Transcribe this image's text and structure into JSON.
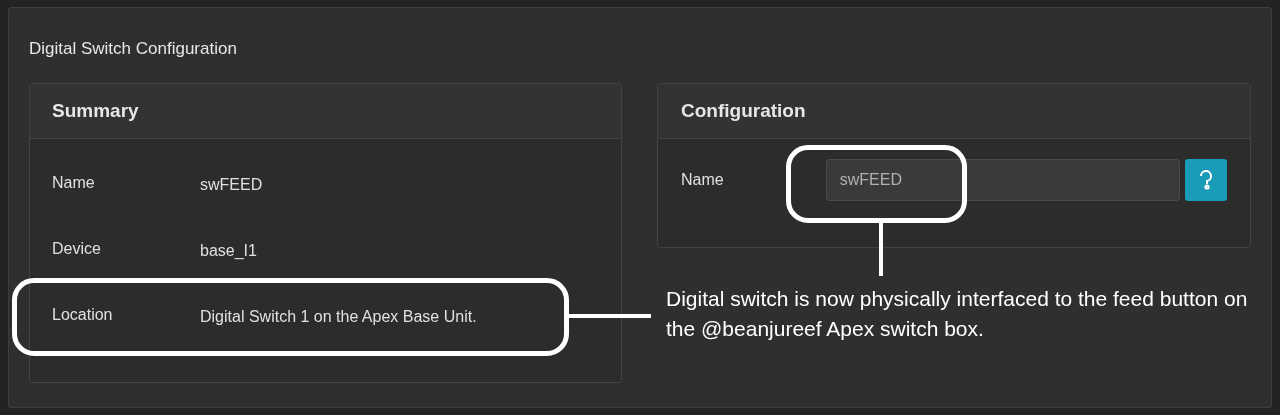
{
  "panel": {
    "title": "Digital Switch Configuration"
  },
  "summary": {
    "title": "Summary",
    "rows": [
      {
        "label": "Name",
        "value": "swFEED"
      },
      {
        "label": "Device",
        "value": "base_I1"
      },
      {
        "label": "Location",
        "value": "Digital Switch 1 on the Apex Base Unit."
      }
    ]
  },
  "configuration": {
    "title": "Configuration",
    "fields": [
      {
        "label": "Name",
        "value": "swFEED"
      }
    ]
  },
  "annotation": {
    "text": "Digital switch is now physically interfaced to the feed button on the @beanjureef Apex switch box."
  }
}
